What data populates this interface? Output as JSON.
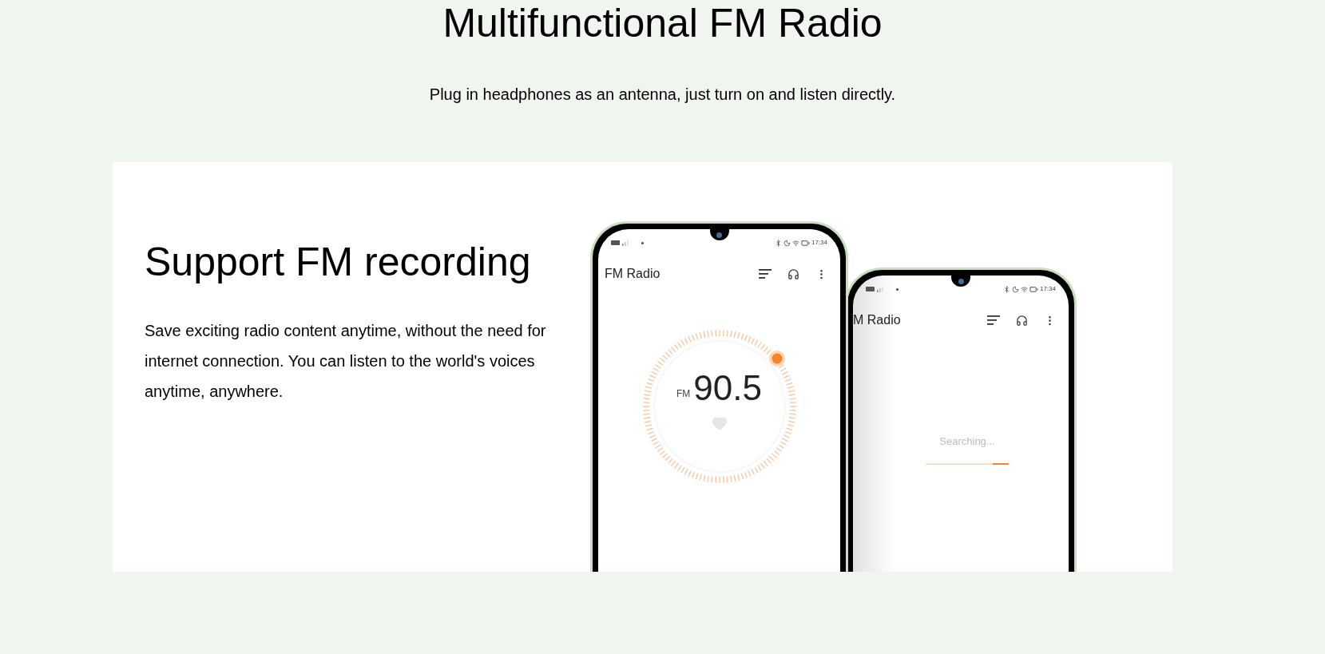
{
  "header": {
    "title": "Multifunctional FM Radio",
    "subtitle": "Plug in headphones as an antenna, just turn on and listen directly."
  },
  "feature": {
    "title": "Support FM recording",
    "text": "Save exciting radio content anytime, without the need for internet connection. You can listen to the world's voices anytime, anywhere."
  },
  "phones": [
    {
      "kind": "tuner",
      "status_time": "17:34",
      "app_title": "FM Radio",
      "band": "FM",
      "frequency": "90.5",
      "favorite": false
    },
    {
      "kind": "search",
      "status_time": "17:34",
      "app_title": "M Radio",
      "message": "Searching..."
    }
  ]
}
